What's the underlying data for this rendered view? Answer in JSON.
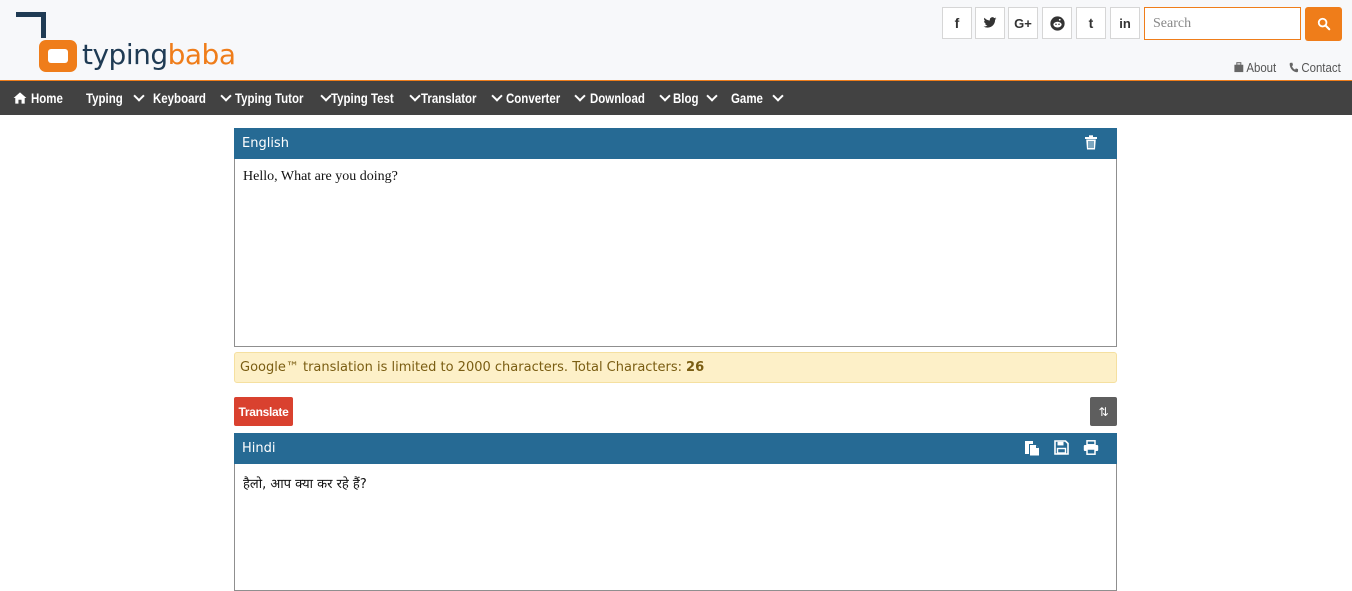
{
  "brand": {
    "part1": "typing",
    "part2": "baba"
  },
  "social": [
    {
      "name": "facebook-icon",
      "glyph": "f"
    },
    {
      "name": "twitter-icon",
      "glyph": "🐦"
    },
    {
      "name": "google-plus-icon",
      "glyph": "G+"
    },
    {
      "name": "reddit-icon",
      "glyph": "●"
    },
    {
      "name": "tumblr-icon",
      "glyph": "t"
    },
    {
      "name": "linkedin-icon",
      "glyph": "in"
    }
  ],
  "search": {
    "placeholder": "Search",
    "value": ""
  },
  "toplinks": {
    "about": "About",
    "contact": "Contact"
  },
  "nav": {
    "home": "Home",
    "typing": "Typing",
    "keyboard": "Keyboard",
    "typing_tutor": "Typing Tutor",
    "typing_test": "Typing Test",
    "translator": "Translator",
    "converter": "Converter",
    "download": "Download",
    "blog": "Blog",
    "game": "Game"
  },
  "source": {
    "language": "English",
    "text": "Hello, What are you doing?"
  },
  "notice": {
    "text": "Google™ translation is limited to 2000 characters. Total Characters:",
    "count": "26"
  },
  "actions": {
    "translate": "Translate",
    "swap": "⇅"
  },
  "target": {
    "language": "Hindi",
    "text": "हैलो, आप क्या कर रहे हैं?"
  },
  "colors": {
    "accent": "#ef7d1a",
    "nav_bg": "#424242",
    "panel_head": "#266a94",
    "translate_btn": "#d9412f"
  }
}
